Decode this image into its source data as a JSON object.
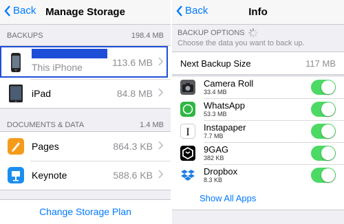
{
  "left": {
    "nav": {
      "back_label": "Back",
      "title": "Manage Storage"
    },
    "backups": {
      "header": "BACKUPS",
      "total": "198.4 MB",
      "items": [
        {
          "name": "This iPhone",
          "size": "113.6 MB",
          "icon": "iphone-icon"
        },
        {
          "name": "iPad",
          "size": "84.8 MB",
          "icon": "ipad-icon"
        }
      ]
    },
    "documents": {
      "header": "DOCUMENTS & DATA",
      "total": "1.4 MB",
      "items": [
        {
          "name": "Pages",
          "size": "864.3 KB",
          "icon": "pages-icon"
        },
        {
          "name": "Keynote",
          "size": "588.6 KB",
          "icon": "keynote-icon"
        }
      ]
    },
    "plan_label": "Change Storage Plan"
  },
  "right": {
    "nav": {
      "back_label": "Back",
      "title": "Info"
    },
    "options": {
      "header": "BACKUP OPTIONS",
      "subtitle": "Choose the data you want to back up."
    },
    "next_backup": {
      "label": "Next Backup Size",
      "value": "117 MB"
    },
    "apps": [
      {
        "name": "Camera Roll",
        "size": "33.4 MB",
        "icon": "camera-icon",
        "enabled": true
      },
      {
        "name": "WhatsApp",
        "size": "53.3 MB",
        "icon": "whatsapp-icon",
        "enabled": true
      },
      {
        "name": "Instapaper",
        "size": "7.7 MB",
        "icon": "instapaper-icon",
        "enabled": true
      },
      {
        "name": "9GAG",
        "size": "382 KB",
        "icon": "9gag-icon",
        "enabled": true
      },
      {
        "name": "Dropbox",
        "size": "8.3 KB",
        "icon": "dropbox-icon",
        "enabled": true
      }
    ],
    "show_all_label": "Show All Apps"
  },
  "colors": {
    "accent": "#007aff",
    "toggle_on": "#4cd964",
    "selection": "#1d4ed8",
    "redaction": "#1d4ed8"
  }
}
